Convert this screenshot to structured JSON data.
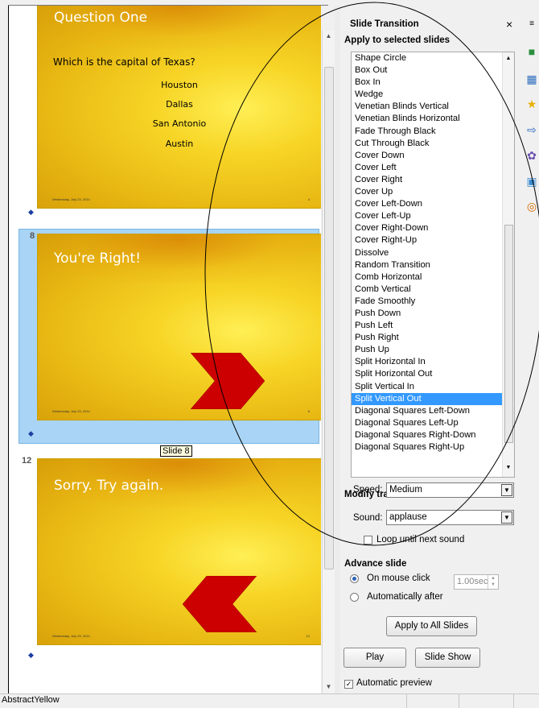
{
  "slides": {
    "slide4": {
      "title": "Question One",
      "question": "Which is the capital of Texas?",
      "answers": [
        "Houston",
        "Dallas",
        "San Antonio",
        "Austin"
      ],
      "footer": "Wednesday, July 23, 2014",
      "page": "4"
    },
    "slide8": {
      "number": "8",
      "title": "You're Right!",
      "footer": "Wednesday, July 23, 2014",
      "page": "8",
      "tooltip": "Slide 8"
    },
    "slide12": {
      "number": "12",
      "title": "Sorry. Try again.",
      "footer": "Wednesday, July 23, 2014",
      "page": "12"
    }
  },
  "pane": {
    "title": "Slide Transition",
    "close": "×",
    "apply_section": "Apply to selected slides",
    "transitions": [
      "Shape Circle",
      "Box Out",
      "Box In",
      "Wedge",
      "Venetian Blinds Vertical",
      "Venetian Blinds Horizontal",
      "Fade Through Black",
      "Cut Through Black",
      "Cover Down",
      "Cover Left",
      "Cover Right",
      "Cover Up",
      "Cover Left-Down",
      "Cover Left-Up",
      "Cover Right-Down",
      "Cover Right-Up",
      "Dissolve",
      "Random Transition",
      "Comb Horizontal",
      "Comb Vertical",
      "Fade Smoothly",
      "Push Down",
      "Push Left",
      "Push Right",
      "Push Up",
      "Split Horizontal In",
      "Split Horizontal Out",
      "Split Vertical In",
      "Split Vertical Out",
      "Diagonal Squares Left-Down",
      "Diagonal Squares Left-Up",
      "Diagonal Squares Right-Down",
      "Diagonal Squares Right-Up"
    ],
    "selected_transition": "Split Vertical Out",
    "modify_section": "Modify transition",
    "speed_label": "Speed:",
    "speed_value": "Medium",
    "sound_label": "Sound:",
    "sound_value": "applause",
    "loop_label": "Loop until next sound",
    "advance_section": "Advance slide",
    "on_click_label": "On mouse click",
    "auto_label": "Automatically after",
    "auto_value": "1.00sec",
    "apply_all": "Apply to All Slides",
    "play": "Play",
    "slideshow": "Slide Show",
    "auto_preview": "Automatic preview"
  },
  "status": {
    "text": "AbstractYellow"
  },
  "colors": {
    "selection": "#3399ff",
    "slide_selected_frame": "#a9d4f5",
    "arrow": "#cc0000"
  }
}
